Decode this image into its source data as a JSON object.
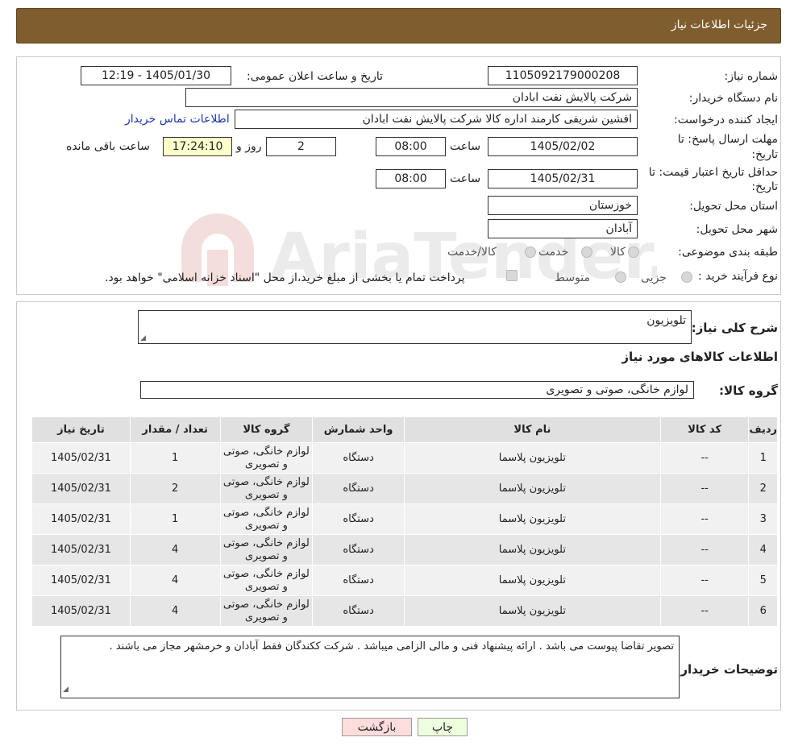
{
  "header": {
    "title": "جزئیات اطلاعات نیاز"
  },
  "form": {
    "need_number_label": "شماره نیاز:",
    "need_number": "1105092179000208",
    "announce_label": "تاریخ و ساعت اعلان عمومی:",
    "announce_value": "1405/01/30 - 12:19",
    "buyer_org_label": "نام دستگاه خریدار:",
    "buyer_org": "شرکت پالایش نفت ابادان",
    "creator_label": "ایجاد کننده درخواست:",
    "creator": "افشین شریفی کارمند اداره کالا  شرکت پالایش نفت ابادان",
    "contact_link": "اطلاعات تماس خریدار",
    "deadline_label_1": "مهلت ارسال پاسخ: تا",
    "deadline_label_2": "تاریخ:",
    "deadline_date": "1405/02/02",
    "time_label": "ساعت",
    "deadline_time": "08:00",
    "days_value": "2",
    "days_label": "روز و",
    "remaining_time": "17:24:10",
    "remaining_label": "ساعت باقی مانده",
    "validity_label_1": "حداقل تاریخ اعتبار قیمت: تا",
    "validity_label_2": "تاریخ:",
    "validity_date": "1405/02/31",
    "validity_time": "08:00",
    "province_label": "استان محل تحویل:",
    "province": "خوزستان",
    "city_label": "شهر محل تحویل:",
    "city": "آبادان",
    "category_label": "طبقه بندی موضوعی:",
    "category_options": [
      "کالا",
      "خدمت",
      "کالا/خدمت"
    ],
    "purchase_type_label": "نوع فرآیند خرید :",
    "purchase_options": [
      "جزیی",
      "متوسط"
    ],
    "purchase_note": "پرداخت تمام یا بخشی از مبلغ خرید،از محل \"اسناد خزانه اسلامی\" خواهد بود."
  },
  "summary": {
    "desc_label": "شرح کلی نیاز:",
    "desc_value": "تلویزیون",
    "goods_info_title": "اطلاعات کالاهای مورد نیاز",
    "group_label": "گروه کالا:",
    "group_value": "لوازم خانگی، صوتی و تصویری"
  },
  "table": {
    "headers": [
      "ردیف",
      "کد کالا",
      "نام کالا",
      "واحد شمارش",
      "گروه کالا",
      "تعداد / مقدار",
      "تاریخ نیاز"
    ],
    "rows": [
      [
        "1",
        "--",
        "تلویزیون پلاسما",
        "دستگاه",
        "لوازم خانگی، صوتی و تصویری",
        "1",
        "1405/02/31"
      ],
      [
        "2",
        "--",
        "تلویزیون پلاسما",
        "دستگاه",
        "لوازم خانگی، صوتی و تصویری",
        "2",
        "1405/02/31"
      ],
      [
        "3",
        "--",
        "تلویزیون پلاسما",
        "دستگاه",
        "لوازم خانگی، صوتی و تصویری",
        "1",
        "1405/02/31"
      ],
      [
        "4",
        "--",
        "تلویزیون پلاسما",
        "دستگاه",
        "لوازم خانگی، صوتی و تصویری",
        "4",
        "1405/02/31"
      ],
      [
        "5",
        "--",
        "تلویزیون پلاسما",
        "دستگاه",
        "لوازم خانگی، صوتی و تصویری",
        "4",
        "1405/02/31"
      ],
      [
        "6",
        "--",
        "تلویزیون پلاسما",
        "دستگاه",
        "لوازم خانگی، صوتی و تصویری",
        "4",
        "1405/02/31"
      ]
    ]
  },
  "notes": {
    "label": "توضیحات خریدار:",
    "value": "تصویر تقاضا پیوست می باشد . ارائه پیشنهاد فنی و مالی الزامی میباشد . شرکت ککندگان فقط آبادان و خرمشهر مجاز می باشند ."
  },
  "buttons": {
    "back": "بازگشت",
    "print": "چاپ"
  },
  "watermark": {
    "text": "AriaTender.neT"
  },
  "colors": {
    "header_bg": "#7f5d2e",
    "link": "#1a3aa8",
    "back_btn": "#ffdddd",
    "print_btn": "#eeffdd"
  }
}
